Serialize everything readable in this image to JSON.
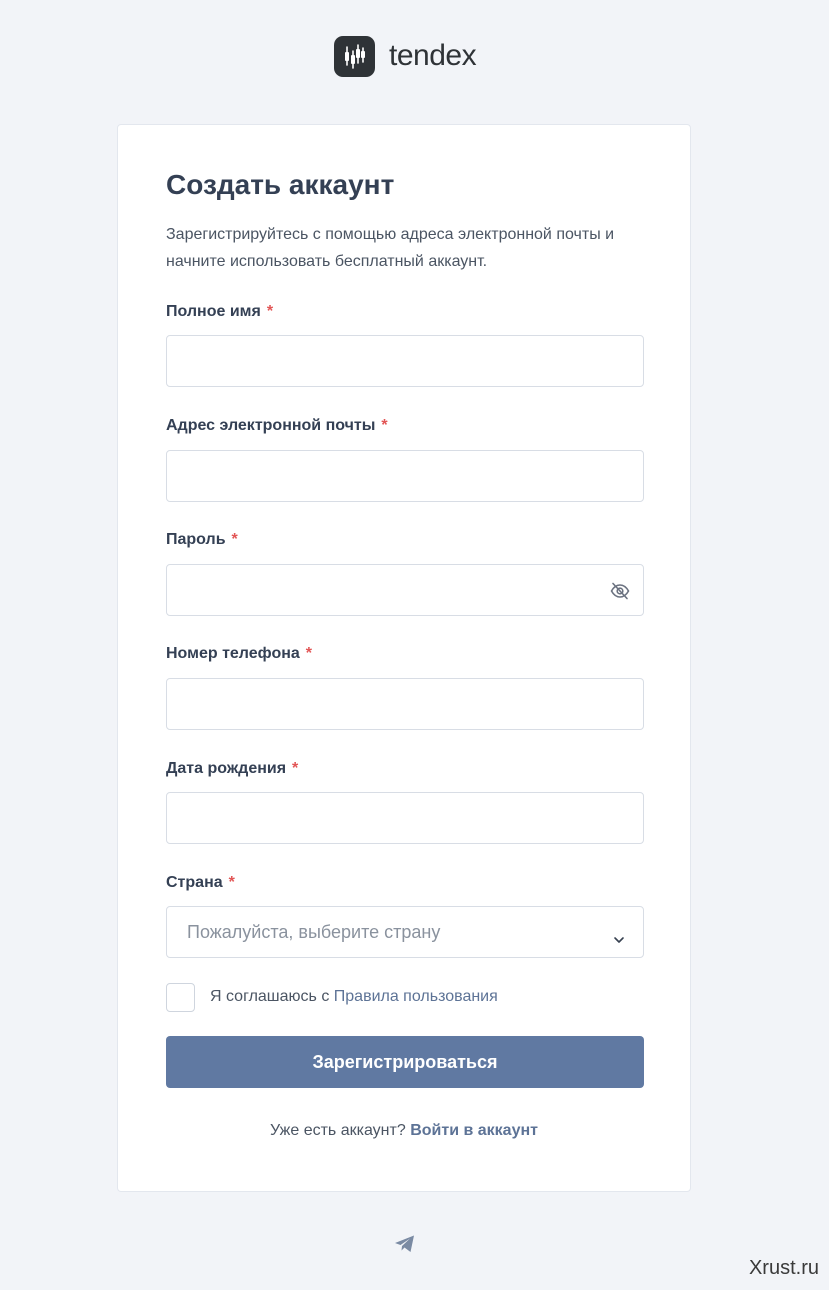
{
  "brand": {
    "name": "tendex"
  },
  "form": {
    "title": "Создать аккаунт",
    "subtitle": "Зарегистрируйтесь с помощью адреса электронной почты и начните использовать бесплатный аккаунт.",
    "required_mark": "*",
    "fields": {
      "full_name": {
        "label": "Полное имя",
        "value": ""
      },
      "email": {
        "label": "Адрес электронной почты",
        "value": ""
      },
      "password": {
        "label": "Пароль",
        "value": "",
        "icon": "eye-off-icon"
      },
      "phone": {
        "label": "Номер телефона",
        "value": ""
      },
      "birth_date": {
        "label": "Дата рождения",
        "value": ""
      },
      "country": {
        "label": "Страна",
        "placeholder": "Пожалуйста, выберите страну",
        "icon": "chevron-down-icon"
      }
    },
    "agree": {
      "checked": false,
      "text": "Я соглашаюсь с",
      "link": "Правила пользования"
    },
    "submit_label": "Зарегистрироваться",
    "login_prompt": {
      "text": "Уже есть аккаунт?",
      "link": "Войти в аккаунт"
    }
  },
  "footer": {
    "icon": "telegram-icon"
  },
  "watermark": "Xrust.ru",
  "colors": {
    "accent": "#6079a2",
    "required": "#e25555",
    "background": "#f2f4f8",
    "link": "#5d7396"
  }
}
